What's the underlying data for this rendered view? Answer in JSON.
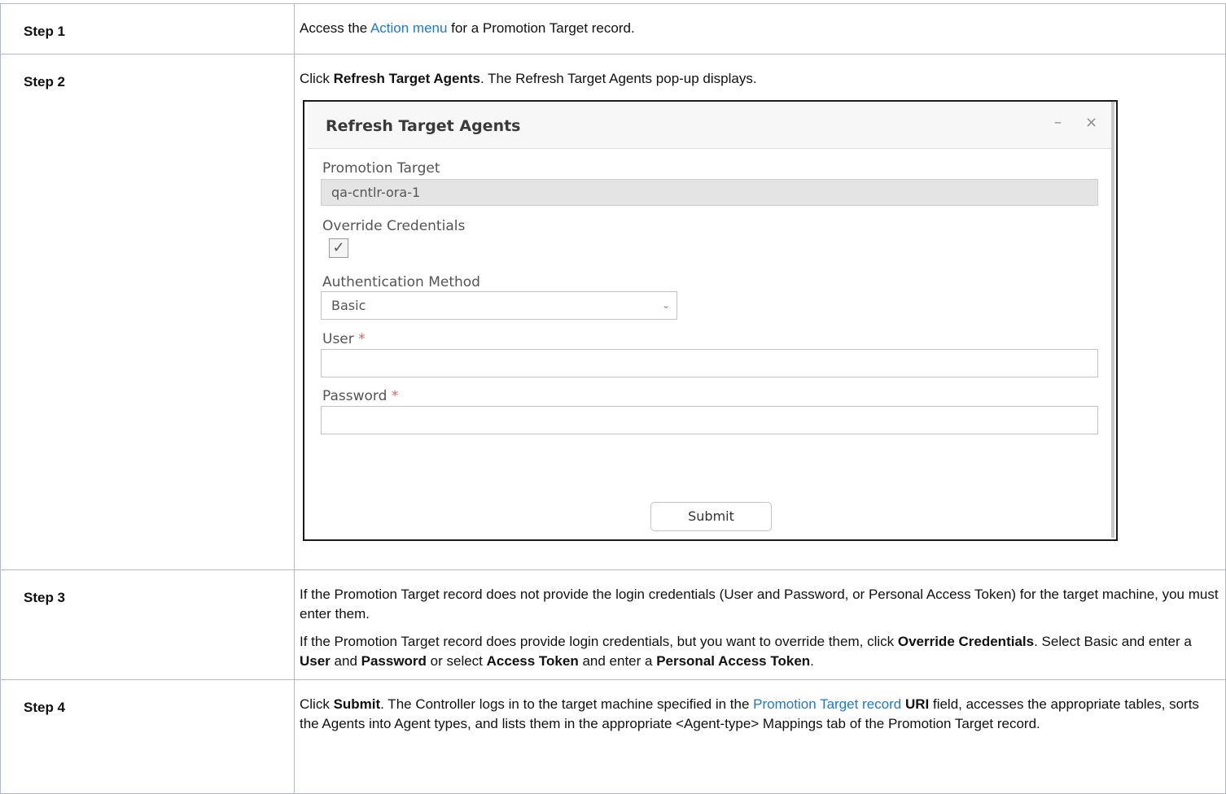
{
  "rows": [
    {
      "step": "Step 1"
    },
    {
      "step": "Step 2"
    },
    {
      "step": "Step 3"
    },
    {
      "step": "Step 4"
    }
  ],
  "step1": {
    "pre": "Access the ",
    "link": "Action menu",
    "post": " for a Promotion Target record."
  },
  "step2": {
    "pre": "Click ",
    "bold": "Refresh Target Agents",
    "post": ". The Refresh Target Agents pop-up displays."
  },
  "dialog": {
    "title": "Refresh Target Agents",
    "minimize": "–",
    "close": "×",
    "promotion_target_label": "Promotion Target",
    "promotion_target_value": "qa-cntlr-ora-1",
    "override_label": "Override Credentials",
    "override_checked": "✓",
    "auth_label": "Authentication Method",
    "auth_value": "Basic",
    "chevron": "⌄",
    "user_label": "User",
    "password_label": "Password",
    "required_mark": "*",
    "submit": "Submit"
  },
  "step3": {
    "p1": "If the Promotion Target record does not provide the login credentials (User and Password, or Personal Access Token) for the target machine, you must enter them.",
    "p2_a": "If the Promotion Target record does provide login credentials, but you want to override them, click ",
    "p2_b": "Override Credentials",
    "p2_c": ". Select Basic and enter a ",
    "p2_d": "User",
    "p2_e": " and ",
    "p2_f": "Password",
    "p2_g": " or select ",
    "p2_h": "Access Token",
    "p2_i": " and enter a ",
    "p2_j": "Personal Access Token",
    "p2_k": "."
  },
  "step4": {
    "a": "Click ",
    "b": "Submit",
    "c": ". The Controller logs in to the target machine specified in the ",
    "link": "Promotion Target record",
    "d": " ",
    "e": "URI",
    "f": " field, accesses the appropriate tables, sorts the Agents into Agent types, and lists them in the appropriate <Agent-type> Mappings tab of the Promotion Target record."
  },
  "colors": {
    "link": "#1f78d1",
    "border": "#b4b8c4",
    "required": "#e06060"
  }
}
